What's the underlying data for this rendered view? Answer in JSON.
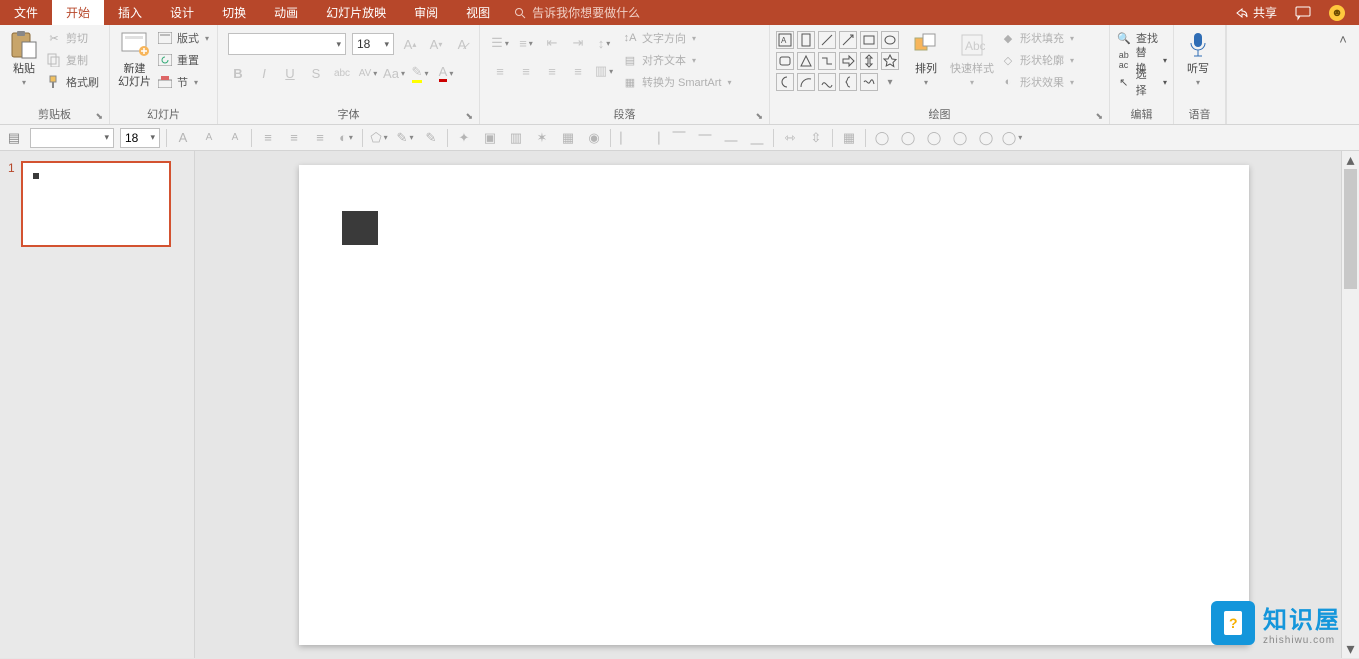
{
  "tabs": {
    "file": "文件",
    "home": "开始",
    "insert": "插入",
    "design": "设计",
    "transitions": "切换",
    "animations": "动画",
    "slideshow": "幻灯片放映",
    "review": "审阅",
    "view": "视图"
  },
  "tell_me": "告诉我你想要做什么",
  "share": "共享",
  "ribbon": {
    "clipboard": {
      "label": "剪贴板",
      "paste": "粘贴",
      "cut": "剪切",
      "copy": "复制",
      "format_painter": "格式刷"
    },
    "slides": {
      "label": "幻灯片",
      "new_slide": "新建\n幻灯片",
      "layout": "版式",
      "reset": "重置",
      "section": "节"
    },
    "font": {
      "label": "字体",
      "size": "18"
    },
    "paragraph": {
      "label": "段落",
      "text_direction": "文字方向",
      "align_text": "对齐文本",
      "convert_smartart": "转换为 SmartArt"
    },
    "drawing": {
      "label": "绘图",
      "arrange": "排列",
      "quick_styles": "快速样式",
      "shape_fill": "形状填充",
      "shape_outline": "形状轮廓",
      "shape_effects": "形状效果"
    },
    "editing": {
      "label": "编辑",
      "find": "查找",
      "replace": "替换",
      "select": "选择"
    },
    "voice": {
      "label": "语音",
      "dictate": "听写"
    }
  },
  "toolbar2": {
    "size": "18"
  },
  "thumbs": {
    "num1": "1"
  },
  "watermark": {
    "cn": "知识屋",
    "en": "zhishiwu.com"
  }
}
